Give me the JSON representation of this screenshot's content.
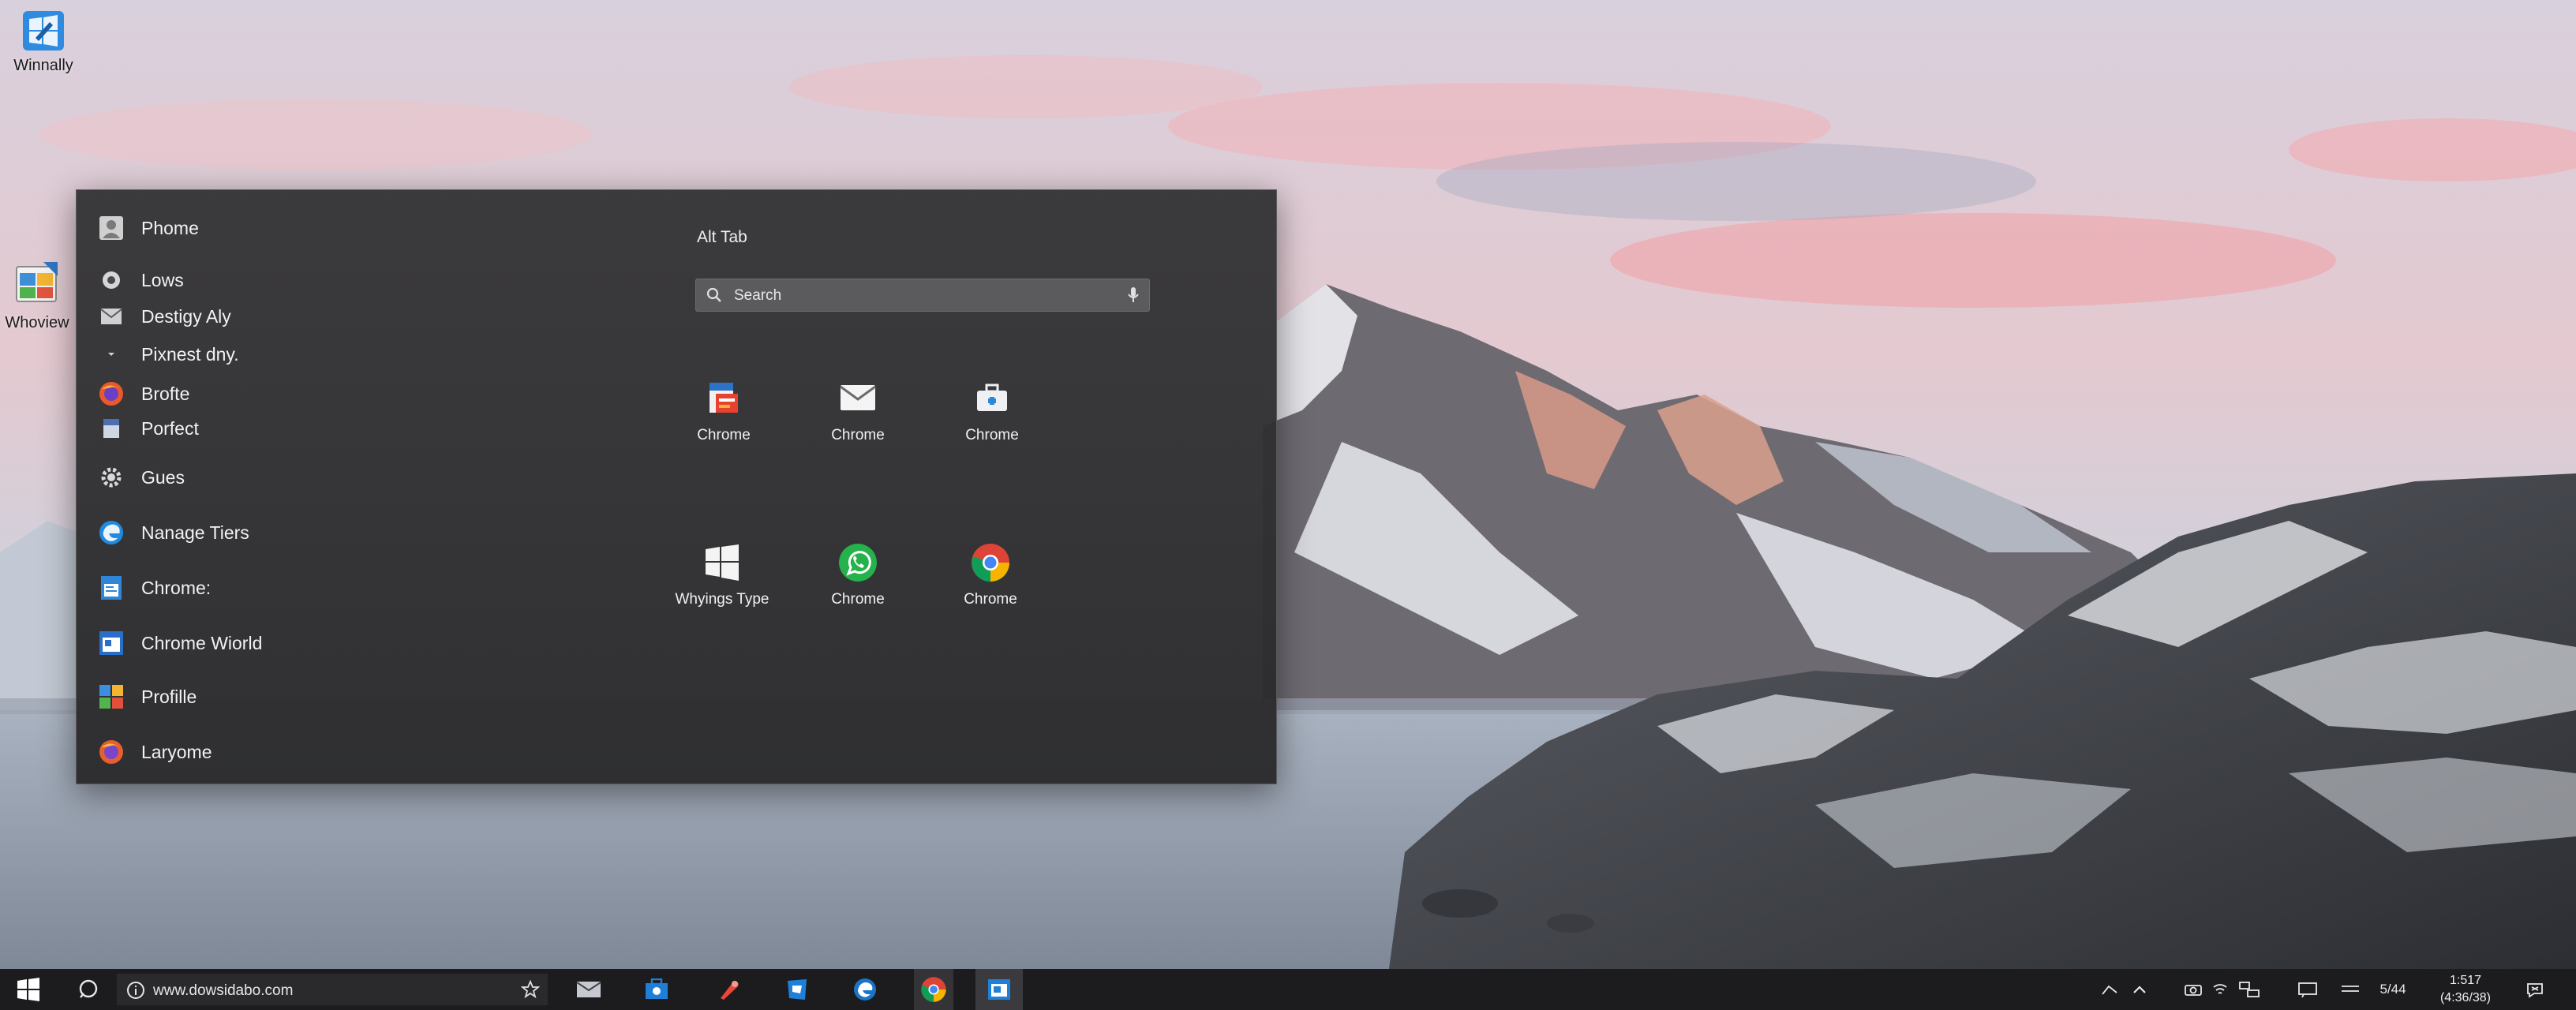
{
  "desktop": {
    "icons": [
      {
        "label": "Winnally"
      },
      {
        "label": "Whoview"
      }
    ]
  },
  "start_menu": {
    "left_items": [
      {
        "label": "Phome",
        "icon": "person-icon"
      },
      {
        "label": "Lows",
        "icon": "circle-icon"
      },
      {
        "label": "Destigy Aly",
        "icon": "mail-icon"
      },
      {
        "label": "Pixnest dny.",
        "icon": "chevron-down-icon"
      },
      {
        "label": "Brofte",
        "icon": "firefox-icon"
      },
      {
        "label": "Porfect",
        "icon": "doc-icon"
      },
      {
        "label": "Gues",
        "icon": "gear-icon"
      },
      {
        "label": "Nanage Tiers",
        "icon": "edge-icon"
      },
      {
        "label": "Chrome:",
        "icon": "file-icon"
      },
      {
        "label": "Chrome Wiorld",
        "icon": "window-icon"
      },
      {
        "label": "Profille",
        "icon": "grid-icon"
      },
      {
        "label": "Laryome",
        "icon": "firefox-icon"
      }
    ],
    "alt_tab_title": "Alt Tab",
    "search": {
      "placeholder": "Search"
    },
    "tiles": [
      {
        "label": "Chrome",
        "icon": "files-app-icon"
      },
      {
        "label": "Chrome",
        "icon": "mail-icon"
      },
      {
        "label": "Chrome",
        "icon": "toolbox-icon"
      },
      {
        "label": "Whyings Type",
        "icon": "windows-logo-icon"
      },
      {
        "label": "Chrome",
        "icon": "whatsapp-icon"
      },
      {
        "label": "Chrome",
        "icon": "chrome-icon"
      }
    ]
  },
  "taskbar": {
    "address": "www.dowsidabo.com",
    "clock_time": "1:517",
    "clock_date": "(4:36/38)",
    "tray_text": "5/44"
  }
}
